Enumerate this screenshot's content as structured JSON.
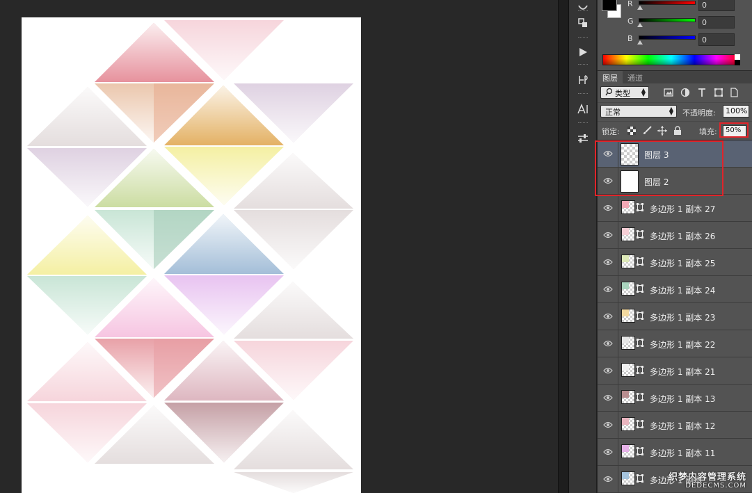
{
  "canvas": {
    "tiles": [
      {
        "id": "t-a",
        "color": "#e58c98"
      },
      {
        "id": "t-b",
        "color": "#f6d3da"
      },
      {
        "id": "t-c",
        "color": "#eac4a9"
      },
      {
        "id": "t-d",
        "color": "#e8a98c"
      },
      {
        "id": "t-e",
        "color": "#e2ad5c"
      },
      {
        "id": "t-f",
        "color": "#ddcfe0"
      },
      {
        "id": "t-g",
        "color": "#c9db9d"
      },
      {
        "id": "t-h",
        "color": "#f4ef9e"
      },
      {
        "id": "t-i",
        "color": "#c6e4d4"
      },
      {
        "id": "t-j",
        "color": "#a0c8b4"
      },
      {
        "id": "t-k",
        "color": "#9fbbd6"
      },
      {
        "id": "t-l",
        "color": "#f6c2e0"
      },
      {
        "id": "t-m",
        "color": "#e7c0f0"
      },
      {
        "id": "t-n",
        "color": "#e79ca3"
      },
      {
        "id": "t-o",
        "color": "#dcb3bd"
      },
      {
        "id": "t-p",
        "color": "#c29ba1"
      },
      {
        "id": "t-q",
        "color": "#e3dcdc"
      }
    ]
  },
  "color_panel": {
    "channels": [
      {
        "label": "R",
        "value": "0",
        "gradient": "#ff0000"
      },
      {
        "label": "G",
        "value": "0",
        "gradient": "#00ff00"
      },
      {
        "label": "B",
        "value": "0",
        "gradient": "#0000ff"
      }
    ]
  },
  "layers_panel": {
    "tabs": [
      "图层",
      "通道"
    ],
    "filter_kind": "类型",
    "blend_mode": "正常",
    "opacity_label": "不透明度:",
    "opacity_value": "100%",
    "lock_label": "锁定:",
    "fill_label": "填充:",
    "fill_value": "50%",
    "layers": [
      {
        "name": "图层 3",
        "selected": true,
        "kind": "raster"
      },
      {
        "name": "图层 2",
        "selected": false,
        "kind": "raster"
      },
      {
        "name": "多边形 1 副本 27",
        "selected": false,
        "kind": "shape",
        "tint": "#f2a8b5"
      },
      {
        "name": "多边形 1 副本 26",
        "selected": false,
        "kind": "shape",
        "tint": "#f6cfd6"
      },
      {
        "name": "多边形 1 副本 25",
        "selected": false,
        "kind": "shape",
        "tint": "#dde9b8"
      },
      {
        "name": "多边形 1 副本 24",
        "selected": false,
        "kind": "shape",
        "tint": "#a9d3bd"
      },
      {
        "name": "多边形 1 副本 23",
        "selected": false,
        "kind": "shape",
        "tint": "#f2d9a0"
      },
      {
        "name": "多边形 1 副本 22",
        "selected": false,
        "kind": "shape",
        "tint": "#e7e7e7"
      },
      {
        "name": "多边形 1 副本 21",
        "selected": false,
        "kind": "shape",
        "tint": "#f0f0f0"
      },
      {
        "name": "多边形 1 副本 13",
        "selected": false,
        "kind": "shape",
        "tint": "#b88d8f"
      },
      {
        "name": "多边形 1 副本 12",
        "selected": false,
        "kind": "shape",
        "tint": "#e9b5bf"
      },
      {
        "name": "多边形 1 副本 11",
        "selected": false,
        "kind": "shape",
        "tint": "#e6b2e8"
      },
      {
        "name": "多边形 1 副本",
        "selected": false,
        "kind": "shape",
        "tint": "#a5c3dc"
      }
    ]
  },
  "watermark": {
    "title": "织梦内容管理系统",
    "url": "DEDECMS.COM"
  }
}
